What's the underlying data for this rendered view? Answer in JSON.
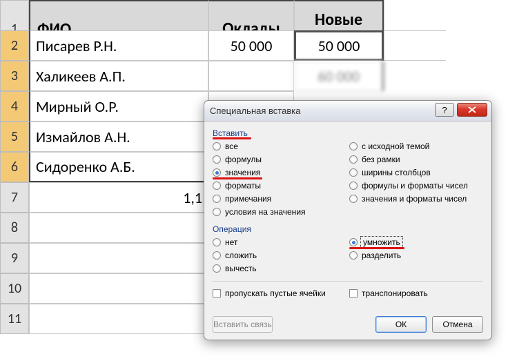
{
  "sheet": {
    "headers": {
      "fio": "ФИО",
      "salary": "Оклады",
      "new_salary": "Новые оклады"
    },
    "row_numbers": [
      "1",
      "2",
      "3",
      "4",
      "5",
      "6",
      "7",
      "8",
      "9",
      "10",
      "11"
    ],
    "rows": [
      {
        "fio": "Писарев Р.Н.",
        "salary": "50 000",
        "new_salary": "50 000"
      },
      {
        "fio": "Халикеев А.П.",
        "salary": "",
        "new_salary": "60 000"
      },
      {
        "fio": "Мирный О.Р.",
        "salary": "",
        "new_salary": ""
      },
      {
        "fio": "Измайлов А.Н.",
        "salary": "",
        "new_salary": ""
      },
      {
        "fio": "Сидоренко А.Б.",
        "salary": "",
        "new_salary": ""
      }
    ],
    "extra_value": "1,1"
  },
  "dialog": {
    "title": "Специальная вставка",
    "group_paste": "Вставить",
    "paste_options": {
      "all": "все",
      "formulas": "формулы",
      "values": "значения",
      "formats": "форматы",
      "comments": "примечания",
      "validation": "условия на значения",
      "source_theme": "с исходной темой",
      "no_border": "без рамки",
      "col_widths": "ширины столбцов",
      "formulas_numfmt": "формулы и форматы чисел",
      "values_numfmt": "значения и форматы чисел"
    },
    "paste_selected": "values",
    "group_op": "Операция",
    "op_options": {
      "none": "нет",
      "add": "сложить",
      "subtract": "вычесть",
      "multiply": "умножить",
      "divide": "разделить"
    },
    "op_selected": "multiply",
    "skip_blanks": "пропускать пустые ячейки",
    "transpose": "транспонировать",
    "paste_link": "Вставить связь",
    "ok": "ОК",
    "cancel": "Отмена"
  }
}
